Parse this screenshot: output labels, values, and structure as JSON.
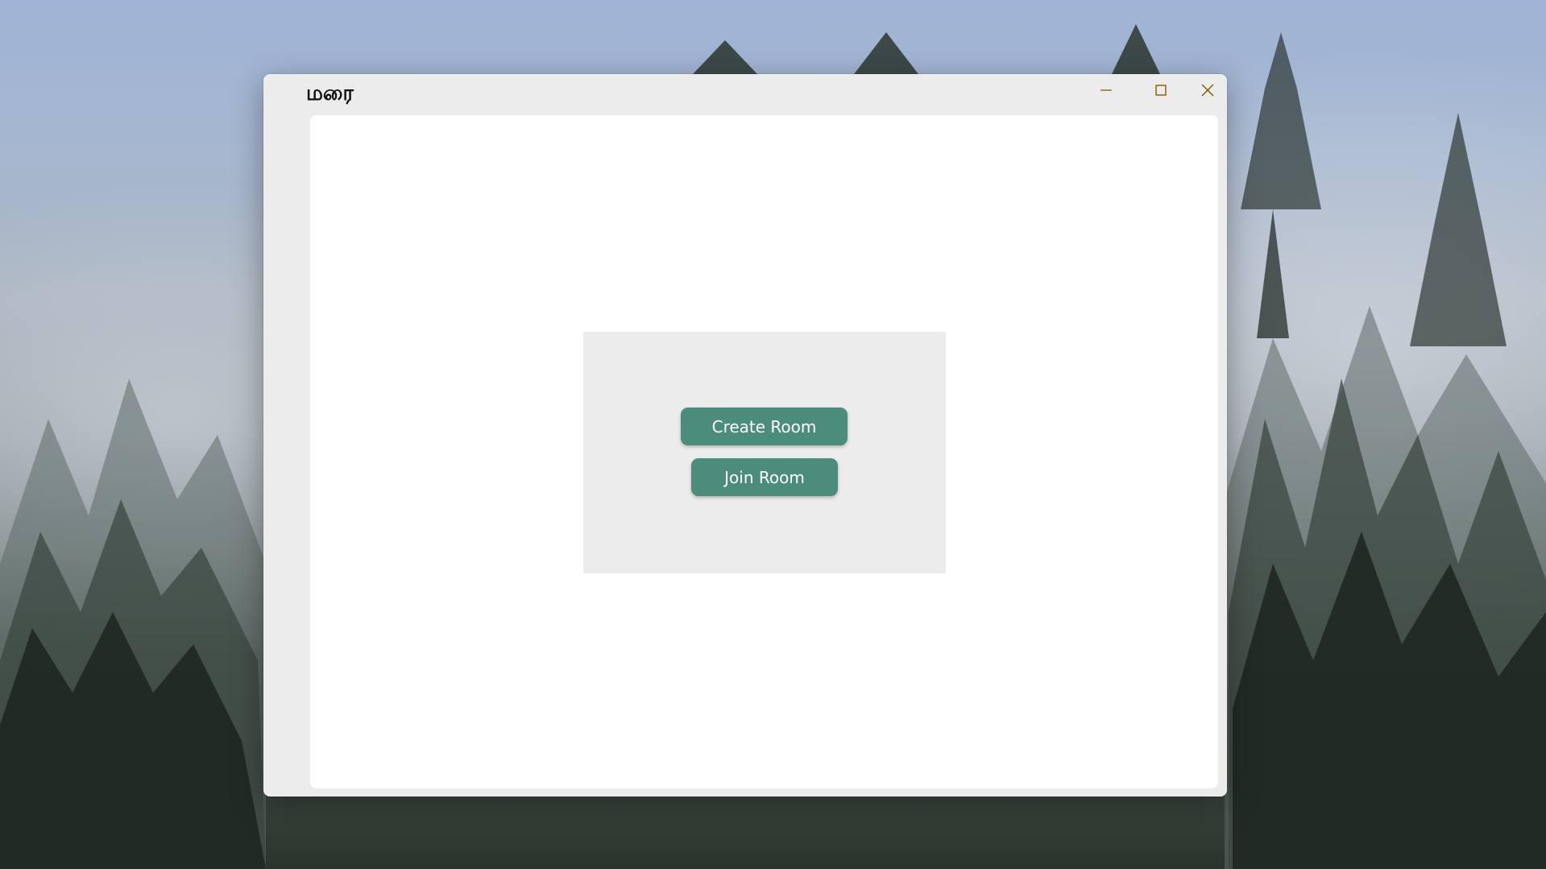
{
  "window": {
    "title": "மரை",
    "controls": {
      "minimize_icon": "minimize-icon",
      "maximize_icon": "maximize-icon",
      "close_icon": "close-icon",
      "control_color": "#8a5a00"
    }
  },
  "main": {
    "create_room_label": "Create Room",
    "join_room_label": "Join Room",
    "button_color": "#4c8c7c"
  }
}
